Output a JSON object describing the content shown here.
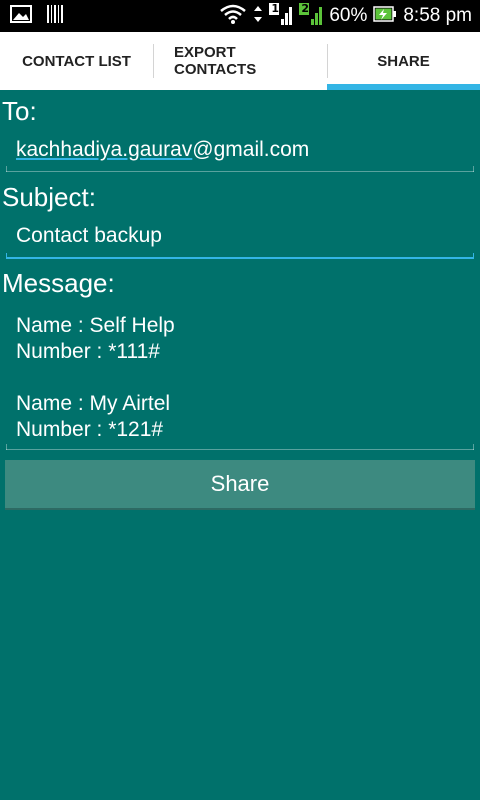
{
  "status_bar": {
    "battery_percent": "60%",
    "time": "8:58 pm",
    "sim1_label": "1",
    "sim2_label": "2",
    "sim2_color": "#5cc43a"
  },
  "tabs": [
    {
      "label": "CONTACT LIST",
      "active": false
    },
    {
      "label": "EXPORT\nCONTACTS",
      "active": false
    },
    {
      "label": "SHARE",
      "active": true
    }
  ],
  "form": {
    "to_label": "To:",
    "to_value_underlined": "kachhadiya.gaurav",
    "to_value_rest": "@gmail.com",
    "subject_label": "Subject:",
    "subject_value": "Contact backup",
    "message_label": "Message:",
    "message_lines": [
      "Name : Self Help",
      "Number : *111#",
      "",
      "Name : My Airtel",
      "Number : *121#"
    ]
  },
  "share_button_label": "Share",
  "colors": {
    "background": "#00716b",
    "accent": "#33b5e5",
    "button": "#3d8a80"
  }
}
